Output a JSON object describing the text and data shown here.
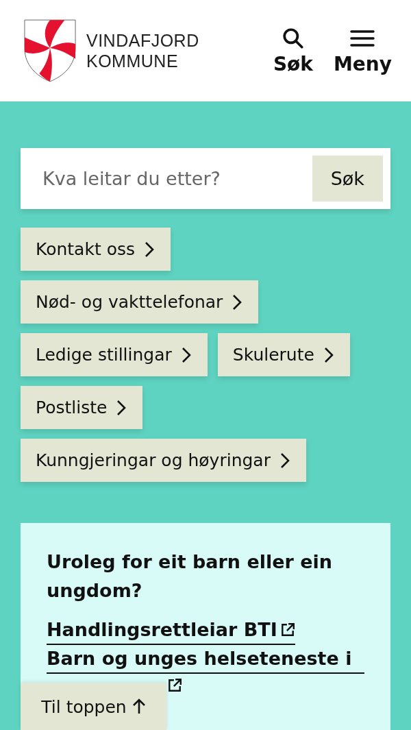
{
  "header": {
    "logo_text": [
      "VINDAFJORD",
      "KOMMUNE"
    ],
    "actions": [
      {
        "kind": "search",
        "label": "Søk"
      },
      {
        "kind": "menu",
        "label": "Meny"
      }
    ]
  },
  "search": {
    "placeholder": "Kva leitar du etter?",
    "button": "Søk"
  },
  "quick_links": [
    {
      "label": "Kontakt oss"
    },
    {
      "label": "Nød- og vakttelefonar"
    },
    {
      "label": "Ledige stillingar"
    },
    {
      "label": "Skulerute"
    },
    {
      "label": "Postliste"
    },
    {
      "label": "Kunngjeringar og høyringar"
    }
  ],
  "card": {
    "heading": "Uroleg for eit barn eller ein ungdom?",
    "links": [
      {
        "label": "Handlingsrettleiar BTI",
        "external": true
      },
      {
        "label": "Barn og unges helseteneste i",
        "external": true
      }
    ]
  },
  "back_to_top": {
    "label": "Til toppen"
  }
}
